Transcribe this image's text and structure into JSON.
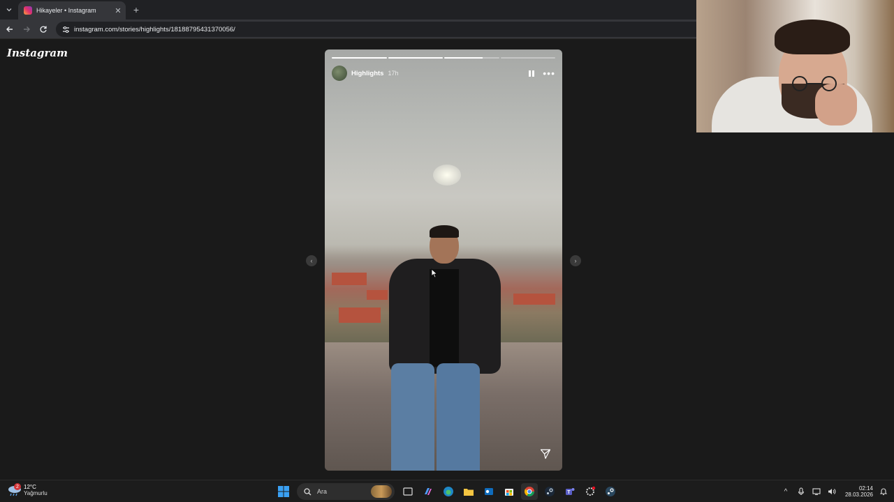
{
  "browser": {
    "tab": {
      "title": "Hikayeler • Instagram",
      "favicon": "instagram-icon"
    },
    "url": "instagram.com/stories/highlights/18188795431370056/"
  },
  "page": {
    "logo": "Instagram",
    "story": {
      "username": "Highlights",
      "time": "17h",
      "progress_segments": [
        1,
        1,
        0.7,
        0
      ],
      "paused": false
    }
  },
  "taskbar": {
    "weather": {
      "temp": "12°C",
      "desc": "Yağmurlu",
      "badge": "2"
    },
    "search_placeholder": "Ara",
    "clock": {
      "time": "02:14",
      "date": "28.03.2026"
    },
    "apps": [
      "windows-start-icon",
      "task-view-icon",
      "copilot-icon",
      "edge-icon",
      "file-explorer-icon",
      "outlook-icon",
      "microsoft-store-icon",
      "chrome-icon",
      "steam-icon",
      "teams-icon",
      "gear-app-icon",
      "steam-alt-icon"
    ]
  },
  "colors": {
    "accent": "#0078d4",
    "instagram_gradient_start": "#f9a43b",
    "instagram_gradient_end": "#8a3ab9"
  }
}
